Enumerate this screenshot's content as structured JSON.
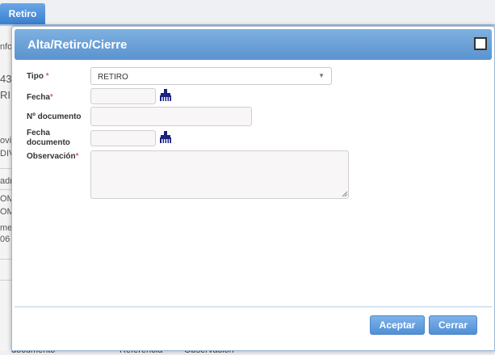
{
  "background": {
    "tab_label": "Retiro",
    "fragments": [
      "nfo",
      "43",
      "RI",
      "ovil",
      "DIV",
      "adr",
      "OM",
      "OM",
      "mer",
      "06"
    ],
    "bottom_labels": [
      "documento",
      "Referencia",
      "Observación"
    ]
  },
  "dialog": {
    "title": "Alta/Retiro/Cierre",
    "fields": {
      "tipo_label": "Tipo",
      "tipo_value": "RETIRO",
      "fecha_label": "Fecha",
      "fecha_value": "",
      "ndoc_label": "Nº documento",
      "ndoc_value": "",
      "fechadoc_label_line1": "Fecha",
      "fechadoc_label_line2": "documento",
      "fechadoc_value": "",
      "obs_label": "Observación",
      "obs_value": ""
    },
    "required_mark": "*",
    "buttons": {
      "accept": "Aceptar",
      "close": "Cerrar"
    }
  },
  "colors": {
    "accent": "#5a93cf",
    "required": "#d02020",
    "calendar_icon": "#1a237e"
  }
}
